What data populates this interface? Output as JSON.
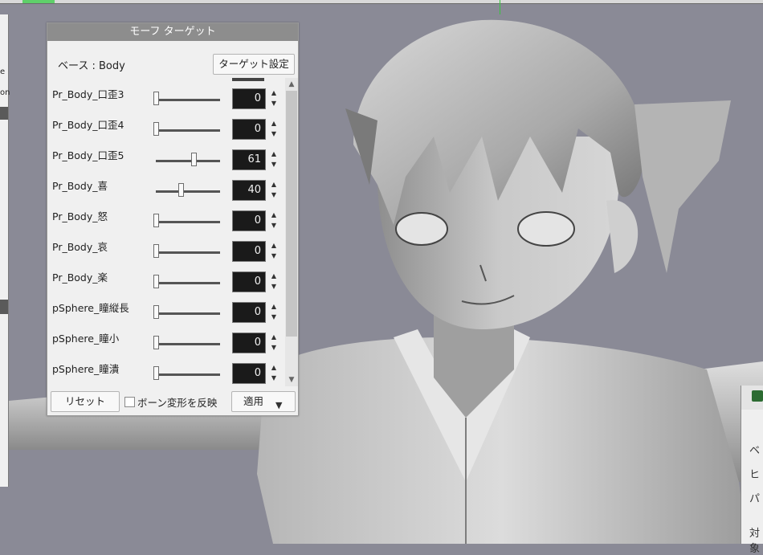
{
  "panel": {
    "title": "モーフ ターゲット",
    "base_label": "ベース : Body",
    "target_button": "ターゲット設定",
    "rows": [
      {
        "name": "Pr_Body_口歪3",
        "value": "0",
        "level": 0.0
      },
      {
        "name": "Pr_Body_口歪4",
        "value": "0",
        "level": 0.0
      },
      {
        "name": "Pr_Body_口歪5",
        "value": "61",
        "level": 0.61
      },
      {
        "name": "Pr_Body_喜",
        "value": "40",
        "level": 0.4
      },
      {
        "name": "Pr_Body_怒",
        "value": "0",
        "level": 0.0
      },
      {
        "name": "Pr_Body_哀",
        "value": "0",
        "level": 0.0
      },
      {
        "name": "Pr_Body_楽",
        "value": "0",
        "level": 0.0
      },
      {
        "name": "pSphere_瞳縦長",
        "value": "0",
        "level": 0.0
      },
      {
        "name": "pSphere_瞳小",
        "value": "0",
        "level": 0.0
      },
      {
        "name": "pSphere_瞳潰",
        "value": "0",
        "level": 0.0
      }
    ],
    "reset_button": "リセット",
    "bone_checkbox_label": "ボーン変形を反映",
    "bone_checkbox_checked": false,
    "apply_button": "適用"
  },
  "background": {
    "left_fragments": [
      "e",
      "on"
    ],
    "right_fragments": [
      "ベ",
      "ヒ",
      "パ",
      "対象"
    ]
  },
  "icons": {
    "spin_up": "spin-up-arrow-icon",
    "spin_down": "spin-down-arrow-icon",
    "apply_dropdown": "dropdown-triangle-icon",
    "scroll_up": "scroll-up-arrow-icon",
    "scroll_down": "scroll-down-arrow-icon"
  },
  "colors": {
    "viewport_bg": "#8a8a96",
    "panel_title_bg": "#8d8d8d",
    "value_box_bg": "#1a1a1a"
  }
}
